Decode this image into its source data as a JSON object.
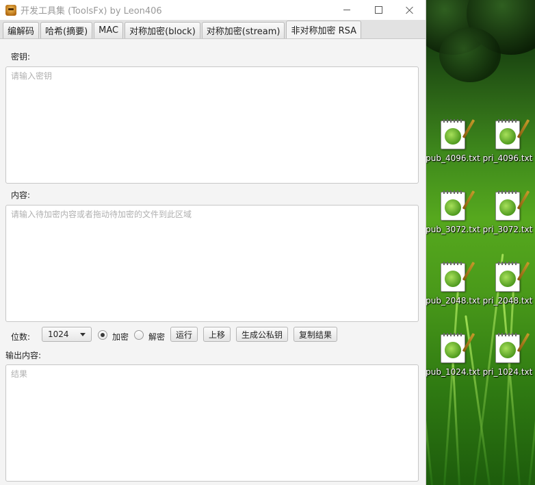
{
  "window": {
    "title": "开发工具集 (ToolsFx) by Leon406"
  },
  "tabs": [
    {
      "label": "编解码",
      "active": false
    },
    {
      "label": "哈希(摘要)",
      "active": false
    },
    {
      "label": "MAC",
      "active": false
    },
    {
      "label": "对称加密(block)",
      "active": false
    },
    {
      "label": "对称加密(stream)",
      "active": false
    },
    {
      "label": "非对称加密 RSA",
      "active": true
    }
  ],
  "key_section": {
    "label": "密钥:",
    "placeholder": "请输入密钥"
  },
  "content_section": {
    "label": "内容:",
    "placeholder": "请输入待加密内容或者拖动待加密的文件到此区域"
  },
  "controls": {
    "bits_label": "位数:",
    "bits_value": "1024",
    "encrypt_label": "加密",
    "decrypt_label": "解密",
    "mode_selected": "加密",
    "run_button": "运行",
    "move_up_button": "上移",
    "gen_keys_button": "生成公私钥",
    "copy_result_button": "复制结果"
  },
  "output_section": {
    "label": "输出内容:",
    "placeholder": "结果"
  },
  "desktop": {
    "icons": [
      {
        "label": "pub_4096.txt"
      },
      {
        "label": "pri_4096.txt"
      },
      {
        "label": "pub_3072.txt"
      },
      {
        "label": "pri_3072.txt"
      },
      {
        "label": "pub_2048.txt"
      },
      {
        "label": "pri_2048.txt"
      },
      {
        "label": "pub_1024.txt"
      },
      {
        "label": "pri_1024.txt"
      }
    ]
  }
}
